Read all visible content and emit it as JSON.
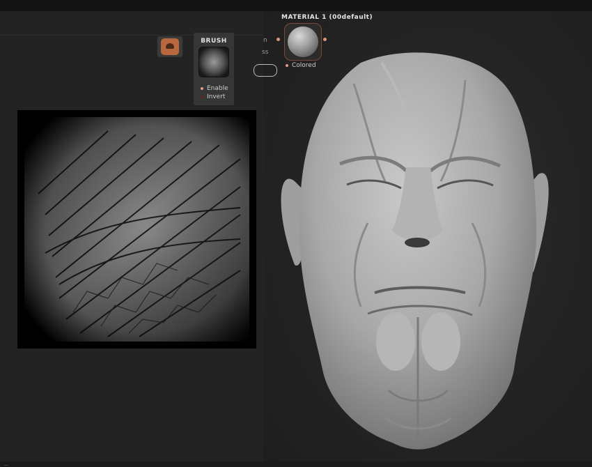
{
  "brush": {
    "title": "BRUSH",
    "options": [
      {
        "label": "Enable",
        "state": "on"
      },
      {
        "label": "Invert",
        "state": "off"
      }
    ]
  },
  "material": {
    "title": "MATERIAL 1 (00default)",
    "option_label": "Colored",
    "cut_labels": [
      "n",
      "ss"
    ]
  },
  "colors": {
    "accent": "#d9987a",
    "brush_icon": "#b8683c",
    "panel_bg": "#232323"
  },
  "icons": {
    "brush_tool": "brush-tool-icon",
    "brush_preview": "brush-alpha-preview-icon",
    "material_preview": "material-sphere-icon"
  },
  "images": {
    "texture": "skin crease alpha texture preview",
    "model": "sculpted head model in 3d viewport"
  },
  "statusbar": {
    "text": "..."
  }
}
